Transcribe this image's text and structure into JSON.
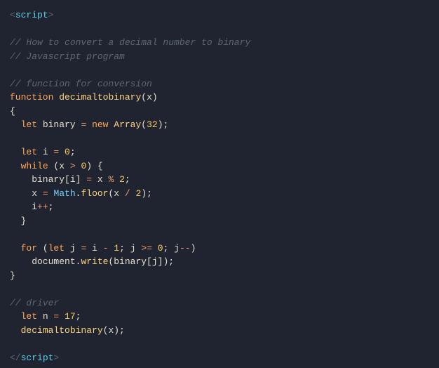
{
  "lines": {
    "l1": {
      "a": "<",
      "b": "script",
      "c": ">"
    },
    "l2": {
      "a": "// How to convert a decimal number to binary"
    },
    "l3": {
      "a": "// Javascript program"
    },
    "l4": {
      "a": "// function for conversion"
    },
    "l5": {
      "a": "function",
      "b": " ",
      "c": "decimaltobinary",
      "d": "(",
      "e": "x",
      "f": ")"
    },
    "l6": {
      "a": "{"
    },
    "l7": {
      "a": "  ",
      "b": "let",
      "c": " binary ",
      "d": "=",
      "e": " ",
      "f": "new",
      "g": " ",
      "h": "Array",
      "i": "(",
      "j": "32",
      "k": ");"
    },
    "l8": {
      "a": "  ",
      "b": "let",
      "c": " i ",
      "d": "=",
      "e": " ",
      "f": "0",
      "g": ";"
    },
    "l9": {
      "a": "  ",
      "b": "while",
      "c": " (x ",
      "d": ">",
      "e": " ",
      "f": "0",
      "g": ") {"
    },
    "l10": {
      "a": "    binary[i] ",
      "b": "=",
      "c": " x ",
      "d": "%",
      "e": " ",
      "f": "2",
      "g": ";"
    },
    "l11": {
      "a": "    x ",
      "b": "=",
      "c": " ",
      "d": "Math",
      "e": ".",
      "f": "floor",
      "g": "(x ",
      "h": "/",
      "i": " ",
      "j": "2",
      "k": ");"
    },
    "l12": {
      "a": "    i",
      "b": "++",
      "c": ";"
    },
    "l13": {
      "a": "  }"
    },
    "l14": {
      "a": "  ",
      "b": "for",
      "c": " (",
      "d": "let",
      "e": " j ",
      "f": "=",
      "g": " i ",
      "h": "-",
      "i": " ",
      "j": "1",
      "k": "; j ",
      "l": ">=",
      "m": " ",
      "n": "0",
      "o": "; j",
      "p": "--",
      "q": ")"
    },
    "l15": {
      "a": "    document",
      "b": ".",
      "c": "write",
      "d": "(binary[j]);"
    },
    "l16": {
      "a": "}"
    },
    "l17": {
      "a": "// driver"
    },
    "l18": {
      "a": "  ",
      "b": "let",
      "c": " n ",
      "d": "=",
      "e": " ",
      "f": "17",
      "g": ";"
    },
    "l19": {
      "a": "  ",
      "b": "decimaltobinary",
      "c": "(x);"
    },
    "l20": {
      "a": "</",
      "b": "script",
      "c": ">"
    }
  }
}
